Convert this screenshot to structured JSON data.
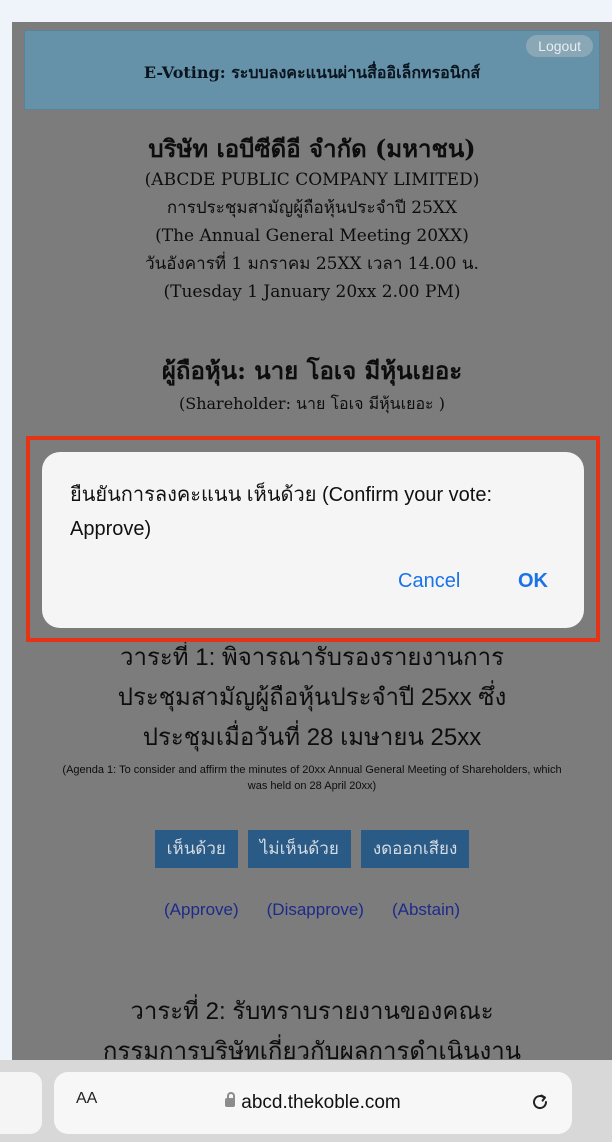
{
  "header": {
    "title": "E-Voting: ระบบลงคะแนนผ่านสื่ออิเล็กทรอนิกส์",
    "logout_label": "Logout"
  },
  "company": {
    "name_thai": "บริษัท เอบีซีดีอี จำกัด (มหาชน)",
    "name_en": "(ABCDE PUBLIC COMPANY LIMITED)",
    "meeting_thai": "การประชุมสามัญผู้ถือหุ้นประจำปี 25XX",
    "meeting_en": "(The Annual General Meeting 20XX)",
    "date_thai": "วันอังคารที่ 1 มกราคม 25XX เวลา 14.00 น.",
    "date_en": "(Tuesday 1 January 20xx 2.00 PM)"
  },
  "shareholder": {
    "title": "ผู้ถือหุ้น: นาย โอเจ มีหุ้นเยอะ",
    "subtitle": "(Shareholder: นาย โอเจ มีหุ้นเยอะ )"
  },
  "dialog": {
    "message": "ยืนยันการลงคะแนน เห็นด้วย (Confirm your vote: Approve)",
    "cancel_label": "Cancel",
    "ok_label": "OK"
  },
  "agenda1": {
    "title_line1": "วาระที่ 1: พิจารณารับรองรายงานการ",
    "title_line2": "ประชุมสามัญผู้ถือหุ้นประจำปี 25xx ซึ่ง",
    "title_line3": "ประชุมเมื่อวันที่ 28 เมษายน 25xx",
    "english": "(Agenda 1: To consider and affirm the minutes of 20xx Annual General Meeting of Shareholders, which was held on 28 April 20xx)",
    "approve_btn": "เห็นด้วย",
    "disapprove_btn": "ไม่เห็นด้วย",
    "abstain_btn": "งดออกเสียง",
    "approve_label": "(Approve)",
    "disapprove_label": "(Disapprove)",
    "abstain_label": "(Abstain)"
  },
  "agenda2": {
    "title_line1": "วาระที่ 2: รับทราบรายงานของคณะ",
    "title_line2": "กรรมการบริษัทเกี่ยวกับผลการดำเนินงาน"
  },
  "browser": {
    "text_size_label": "AA",
    "url": "abcd.thekoble.com",
    "reload_icon": "reload-icon",
    "lock_icon": "lock-icon"
  },
  "colors": {
    "highlight_border": "#e53316",
    "button_blue": "#2a5a86",
    "link_blue": "#1a73e8"
  }
}
